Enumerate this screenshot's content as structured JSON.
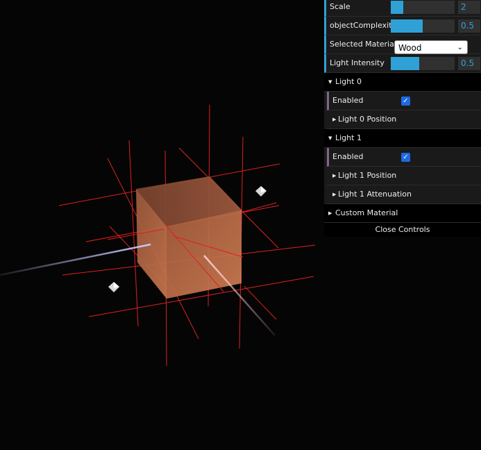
{
  "gui": {
    "scale": {
      "label": "Scale",
      "value": "2",
      "fill": 0.2
    },
    "complexity": {
      "label": "objectComplexity",
      "value": "0.5",
      "fill": 0.5
    },
    "material": {
      "label": "Selected Material",
      "value": "Wood"
    },
    "light_intensity": {
      "label": "Light Intensity",
      "value": "0.5",
      "fill": 0.45
    },
    "light0": {
      "folder_label": "Light 0",
      "enabled_label": "Enabled",
      "position_label": "Light 0 Position"
    },
    "light1": {
      "folder_label": "Light 1",
      "enabled_label": "Enabled",
      "position_label": "Light 1 Position",
      "attenuation_label": "Light 1 Attenuation"
    },
    "custom_material_label": "Custom Material",
    "close_label": "Close Controls"
  },
  "colors": {
    "accent_blue": "#2fa1d6",
    "bool_purple": "#806787",
    "grid_red": "#e02020",
    "cube": "#b86a4a",
    "light_green": "#b5f0b0",
    "light_blue": "#c8c8ff",
    "light_pink": "#ffc8c8"
  },
  "icons": {
    "folder_open": "caret-down-icon",
    "folder_closed": "caret-right-icon",
    "checkbox": "checkmark-icon",
    "select": "chevron-down-icon"
  }
}
